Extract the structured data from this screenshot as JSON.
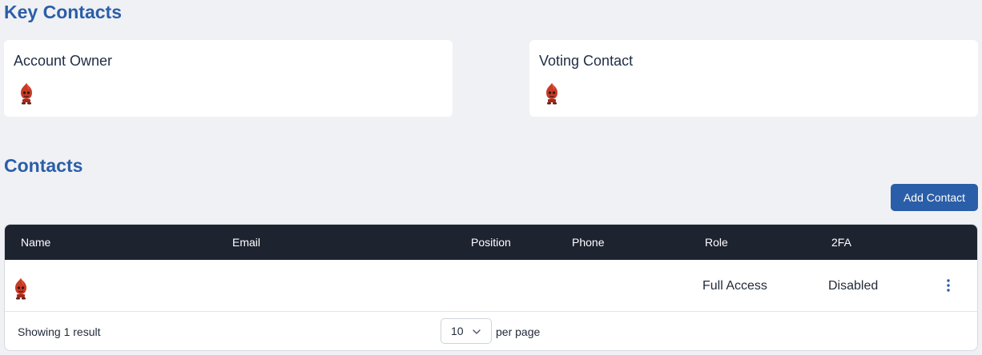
{
  "key_contacts": {
    "title": "Key Contacts",
    "cards": [
      {
        "label": "Account Owner",
        "avatar_icon": "red-mascot-icon"
      },
      {
        "label": "Voting Contact",
        "avatar_icon": "red-mascot-icon"
      }
    ]
  },
  "contacts": {
    "title": "Contacts",
    "add_button_label": "Add Contact",
    "table": {
      "columns": [
        "Name",
        "Email",
        "Position",
        "Phone",
        "Role",
        "2FA"
      ],
      "rows": [
        {
          "name": "",
          "email": "",
          "position": "",
          "phone": "",
          "role": "Full Access",
          "twofa": "Disabled",
          "avatar_icon": "red-mascot-icon",
          "actions_icon": "kebab-menu-icon"
        }
      ]
    },
    "footer": {
      "showing": "Showing 1 result",
      "per_page_value": "10",
      "per_page_label": "per page"
    }
  },
  "colors": {
    "accent": "#2b5ea8",
    "table_header_bg": "#1e2330",
    "page_bg": "#f0f1f4"
  }
}
